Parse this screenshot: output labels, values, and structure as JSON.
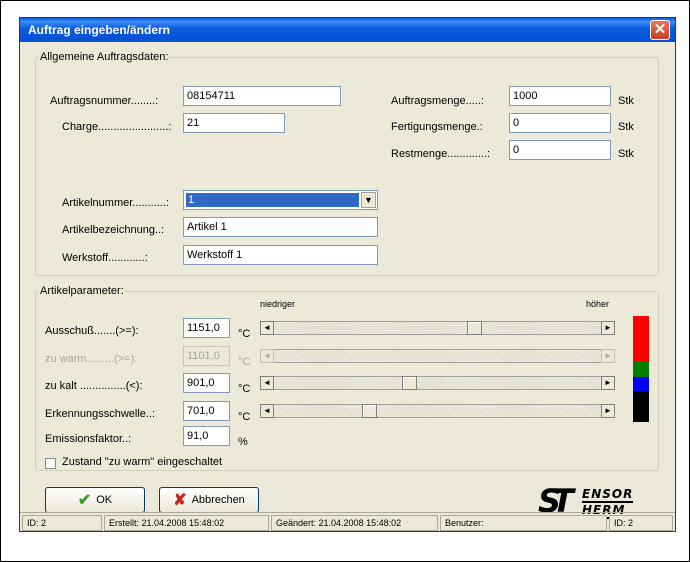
{
  "window": {
    "title": "Auftrag eingeben/ändern",
    "close_glyph": "✕"
  },
  "general": {
    "legend": "Allgemeine Auftragsdaten:",
    "auftragsnummer_label": "Auftragsnummer........:",
    "auftragsnummer_value": "08154711",
    "charge_label": "Charge.......................:",
    "charge_value": "21",
    "auftragsmenge_label": "Auftragsmenge.....:",
    "auftragsmenge_value": "1000",
    "fertigungsmenge_label": "Fertigungsmenge.:",
    "fertigungsmenge_value": "0",
    "restmenge_label": "Restmenge.............:",
    "restmenge_value": "0",
    "unit_stk": "Stk",
    "artikelnummer_label": "Artikelnummer...........:",
    "artikelnummer_value": "1",
    "artikelbezeichnung_label": "Artikelbezeichnung..:",
    "artikelbezeichnung_value": "Artikel 1",
    "werkstoff_label": "Werkstoff............:",
    "werkstoff_value": "Werkstoff 1"
  },
  "params": {
    "legend": "Artikelparameter:",
    "scale_low": "niedriger",
    "scale_high": "höher",
    "unit_celsius": "°C",
    "unit_percent": "%",
    "rows": [
      {
        "label": "Ausschuß.......(>=):",
        "value": "1151,0",
        "level": 0.62,
        "enabled": true
      },
      {
        "label": "zu warm.........(>=):",
        "value": "1101,0",
        "level": 0.0,
        "enabled": false
      },
      {
        "label": "zu kalt ...............(<):",
        "value": "901,0",
        "level": 0.41,
        "enabled": true
      },
      {
        "label": "Erkennungsschwelle..:",
        "value": "701,0",
        "level": 0.28,
        "enabled": true
      }
    ],
    "emission_label": "Emissionsfaktor..:",
    "emission_value": "91,0",
    "checkbox_label": "Zustand \"zu warm\" eingeschaltet",
    "colors": [
      "#ff0000",
      "#ff0000",
      "#008000",
      "#0000ff",
      "#000000"
    ]
  },
  "buttons": {
    "ok": "OK",
    "cancel": "Abbrechen"
  },
  "logo": {
    "line1": "ENSOR",
    "line2": "HERM",
    "letter_s": "S",
    "letter_t": "T"
  },
  "status": {
    "id_left": "ID: 2",
    "created": "Erstellt: 21.04.2008 15:48:02",
    "changed": "Geändert: 21.04.2008 15:48:02",
    "user": "Benutzer:",
    "id_right": "ID: 2"
  }
}
